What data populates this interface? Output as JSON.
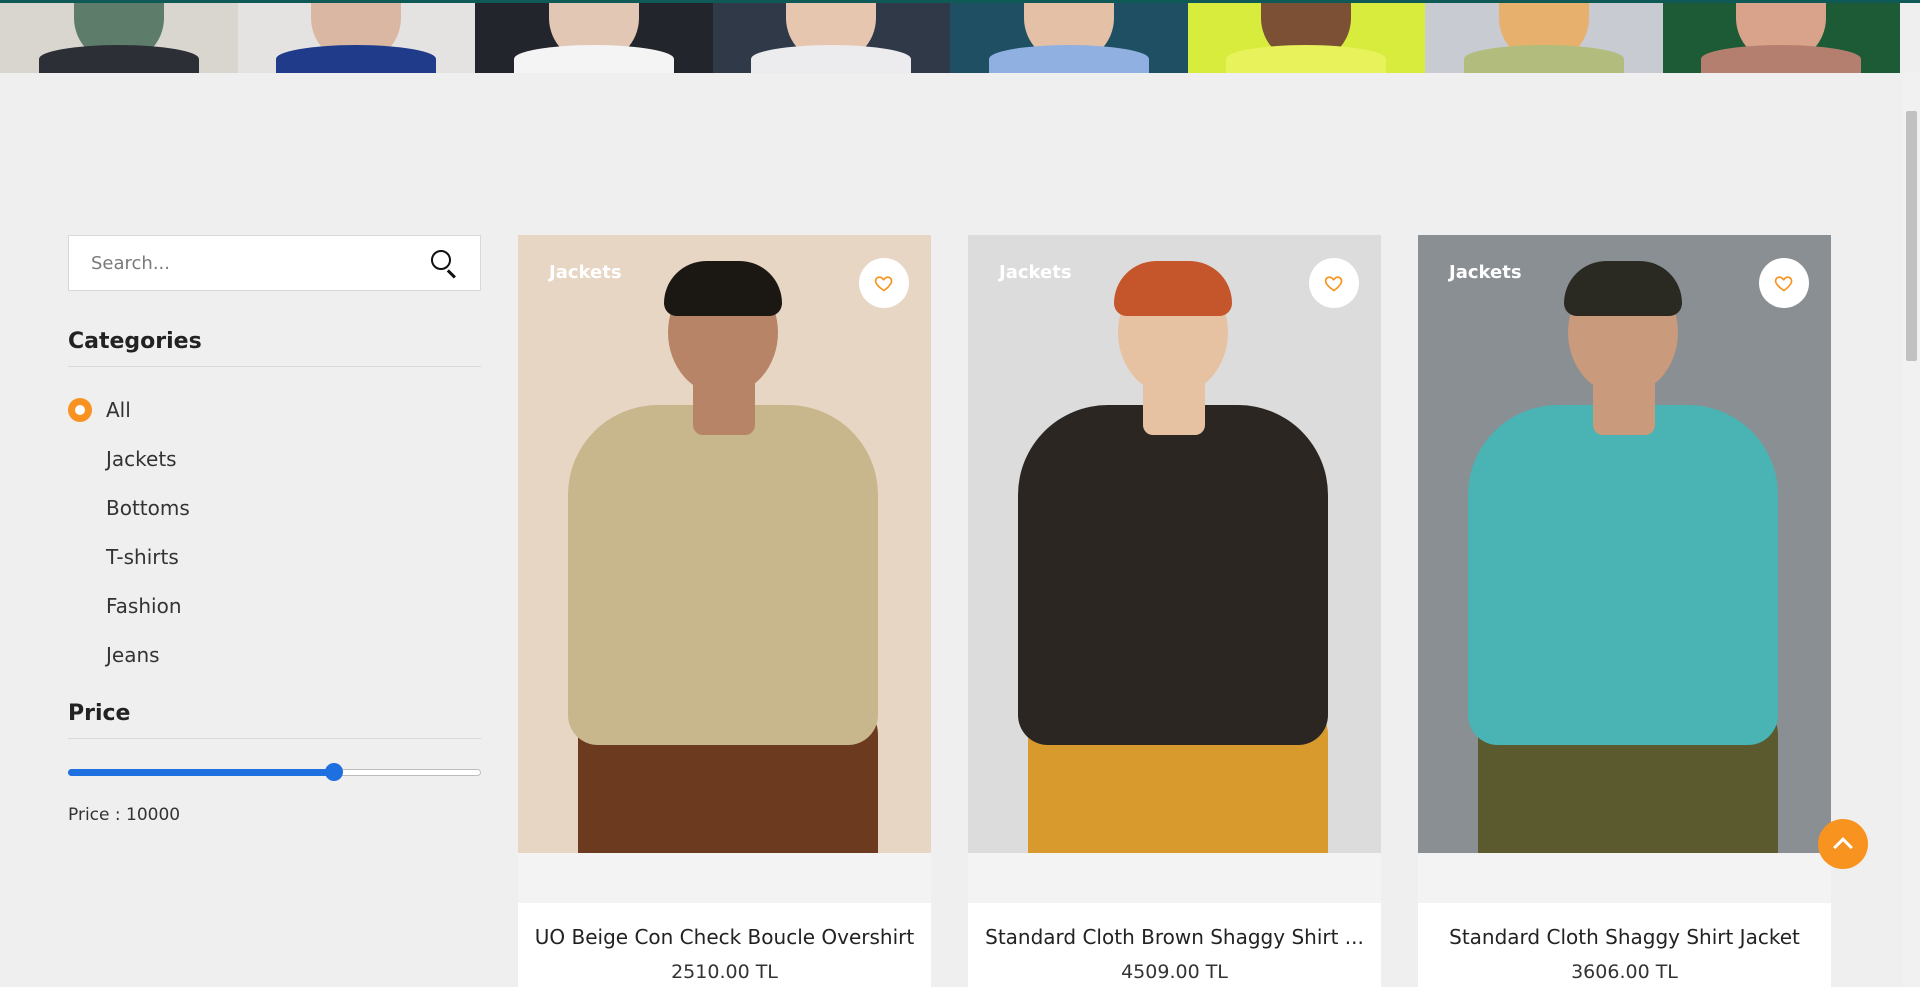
{
  "banner": {
    "photos": [
      {
        "bg": "#d9d6cf",
        "neck": "#5d7d6a",
        "collar": "#2c2f36"
      },
      {
        "bg": "#e4e3e2",
        "neck": "#d9b7a3",
        "collar": "#1f3b8a"
      },
      {
        "bg": "#22252c",
        "neck": "#e2c7b4",
        "collar": "#f4f4f4"
      },
      {
        "bg": "#2f3948",
        "neck": "#e7c6b0",
        "collar": "#ecebee"
      },
      {
        "bg": "#1f4f63",
        "neck": "#e4c1a6",
        "collar": "#8fb0e0"
      },
      {
        "bg": "#d8ec3e",
        "neck": "#7b5034",
        "collar": "#e8f25a"
      },
      {
        "bg": "#c9cbd2",
        "neck": "#e7b06c",
        "collar": "#b2bc7c"
      },
      {
        "bg": "#1c5b35",
        "neck": "#d8a38a",
        "collar": "#b57f6f"
      }
    ]
  },
  "search": {
    "placeholder": "Search...",
    "value": ""
  },
  "categories": {
    "title": "Categories",
    "items": [
      {
        "label": "All",
        "selected": true
      },
      {
        "label": "Jackets",
        "selected": false
      },
      {
        "label": "Bottoms",
        "selected": false
      },
      {
        "label": "T-shirts",
        "selected": false
      },
      {
        "label": "Fashion",
        "selected": false
      },
      {
        "label": "Jeans",
        "selected": false
      }
    ]
  },
  "price_filter": {
    "title": "Price",
    "fraction": 0.645,
    "label": "Price : 10000"
  },
  "products": [
    {
      "category": "Jackets",
      "name": "UO Beige Con Check Boucle Overshirt",
      "price": "2510.00 TL",
      "bg": "#e8d6c4",
      "shirt": "#c8b68d",
      "pants": "#6b3a1f",
      "hair": "#1b1713",
      "skin": "#b88468"
    },
    {
      "category": "Jackets",
      "name": "Standard Cloth Brown Shaggy Shirt ...",
      "price": "4509.00 TL",
      "bg": "#dcdcdc",
      "shirt": "#2b2622",
      "pants": "#d89a2c",
      "hair": "#c5552a",
      "skin": "#e6c2a2"
    },
    {
      "category": "Jackets",
      "name": "Standard Cloth Shaggy Shirt Jacket",
      "price": "3606.00 TL",
      "bg": "#8a8f93",
      "shirt": "#4ab3b3",
      "pants": "#5a5a2e",
      "hair": "#2a2a22",
      "skin": "#c99a7b"
    }
  ],
  "colors": {
    "accent": "#f7931e",
    "slider": "#1e6fe0",
    "topline": "#0f5a57"
  }
}
